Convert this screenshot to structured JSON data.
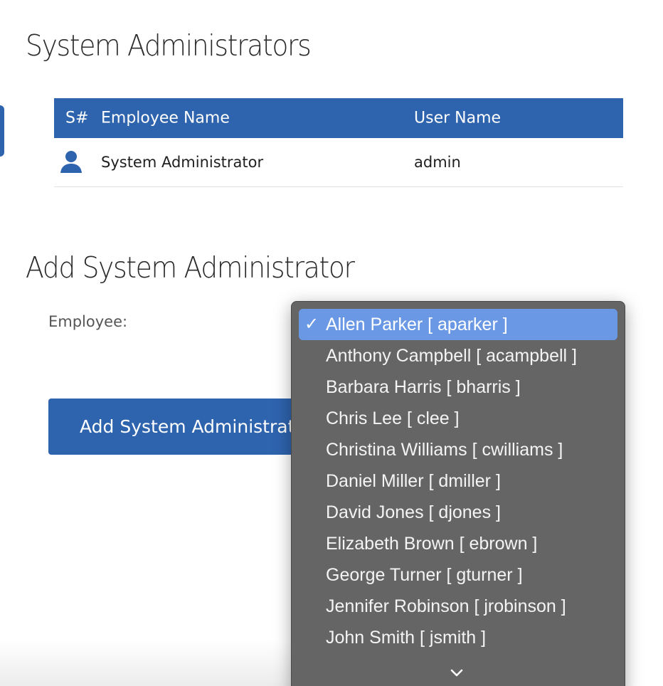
{
  "headings": {
    "admins": "System Administrators",
    "add": "Add System Administrator"
  },
  "table": {
    "headers": {
      "sn": "S#",
      "name": "Employee Name",
      "user": "User Name"
    },
    "rows": [
      {
        "icon": "user-icon",
        "name": "System Administrator",
        "user": "admin"
      }
    ]
  },
  "form": {
    "employee_label": "Employee:",
    "submit_label": "Add System Administrator"
  },
  "dropdown": {
    "selected_index": 0,
    "options": [
      "Allen Parker [ aparker ]",
      "Anthony Campbell [ acampbell ]",
      "Barbara Harris [ bharris ]",
      "Chris Lee [ clee ]",
      "Christina Williams [ cwilliams ]",
      "Daniel Miller [ dmiller ]",
      "David Jones [ djones ]",
      "Elizabeth Brown [ ebrown ]",
      "George Turner [ gturner ]",
      "Jennifer Robinson [ jrobinson ]",
      "John Smith [ jsmith ]"
    ],
    "check_glyph": "✓",
    "more_icon": "chevron-down-icon"
  },
  "colors": {
    "accent": "#2e63ad",
    "menu_bg": "#666566",
    "menu_selected": "#6a98e4"
  }
}
